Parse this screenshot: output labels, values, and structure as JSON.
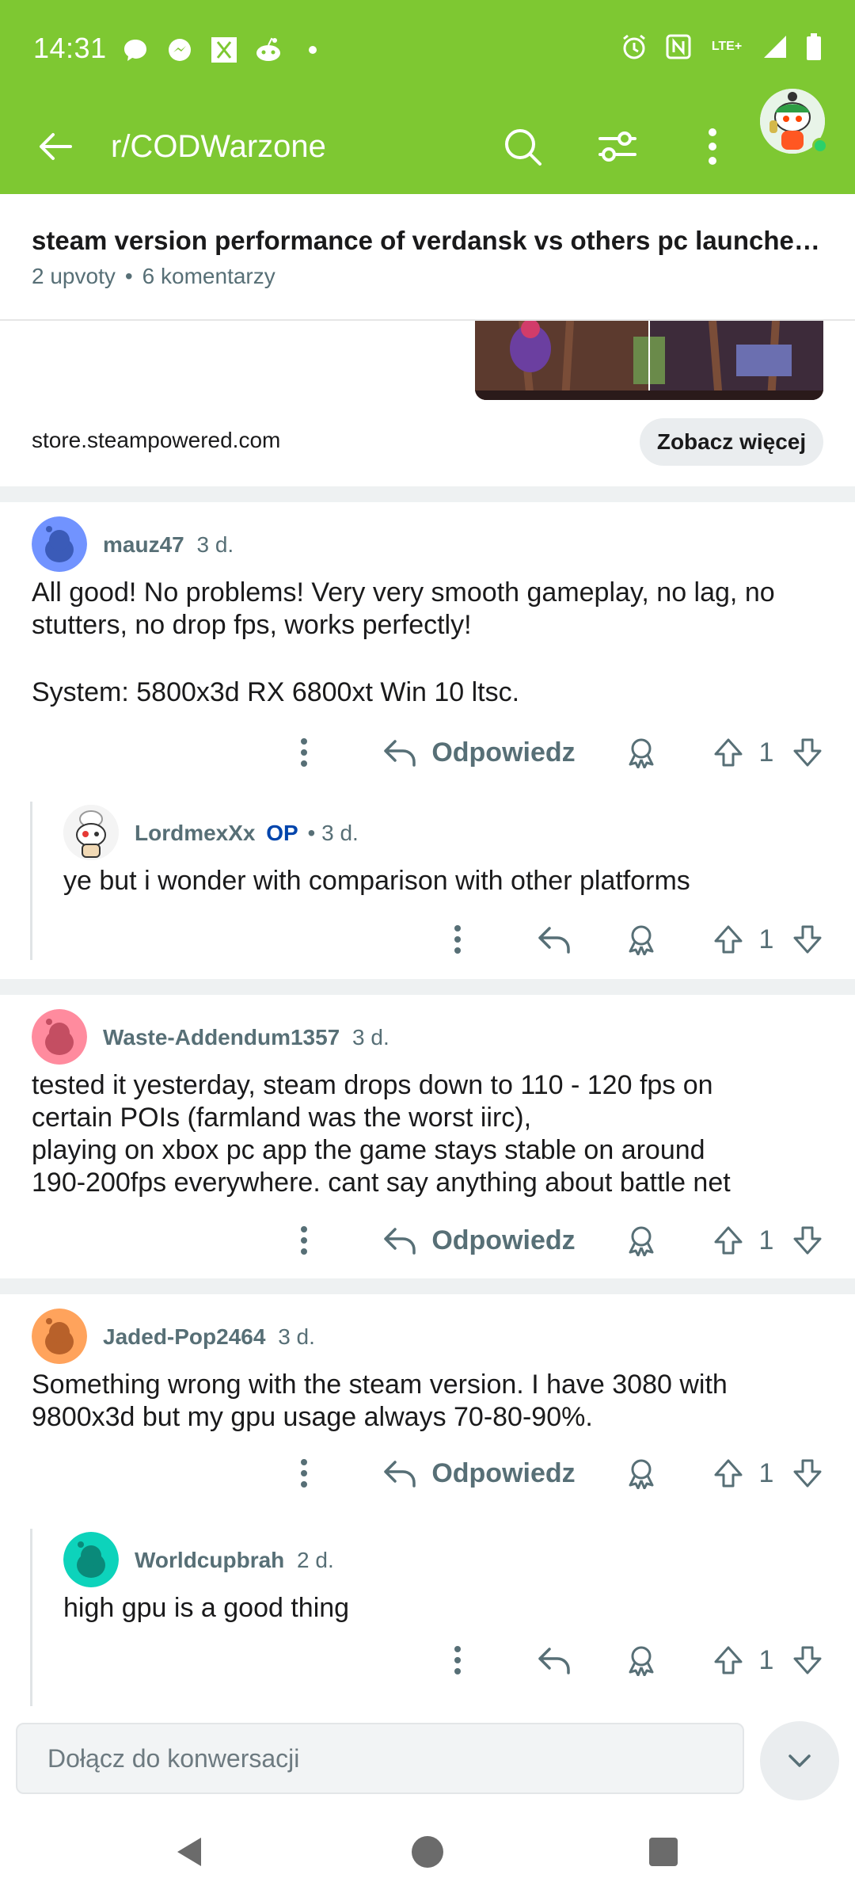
{
  "status_bar": {
    "time": "14:31",
    "network": "LTE+"
  },
  "app_bar": {
    "subreddit": "r/CODWarzone"
  },
  "post": {
    "title": "steam version performance of verdansk vs others pc launche…",
    "upvotes": "2 upvoty",
    "comments": "6 komentarzy",
    "link_domain": "store.steampowered.com",
    "see_more": "Zobacz więcej"
  },
  "comments": [
    {
      "author": "mauz47",
      "age": "3 d.",
      "body_lines": [
        "All good! No problems! Very very smooth gameplay, no lag, no",
        "stutters, no drop fps, works perfectly!",
        "",
        "System: 5800x3d RX 6800xt Win 10 ltsc."
      ],
      "reply_label": "Odpowiedz",
      "votes": "1"
    },
    {
      "author": "LordmexXx",
      "op": "OP",
      "age": "3 d.",
      "body_lines": [
        "ye but i wonder with comparison with other platforms"
      ],
      "votes": "1"
    },
    {
      "author": "Waste-Addendum1357",
      "age": "3 d.",
      "body_lines": [
        "tested it yesterday, steam drops down to 110 - 120 fps on",
        "certain POIs (farmland was the worst iirc),",
        "playing on xbox pc app the game stays stable on around",
        "190-200fps everywhere. cant say anything about battle net"
      ],
      "reply_label": "Odpowiedz",
      "votes": "1"
    },
    {
      "author": "Jaded-Pop2464",
      "age": "3 d.",
      "body_lines": [
        "Something wrong with the steam version. I have 3080 with",
        "9800x3d but my gpu usage always 70-80-90%."
      ],
      "reply_label": "Odpowiedz",
      "votes": "1"
    },
    {
      "author": "Worldcupbrah",
      "age": "2 d.",
      "body_lines": [
        "high gpu is a good thing"
      ],
      "votes": "1"
    }
  ],
  "join_input": {
    "placeholder": "Dołącz do konwersacji"
  },
  "colors": {
    "brand_green": "#7ec832",
    "op_blue": "#0045ac",
    "meta_gray": "#576f76"
  }
}
